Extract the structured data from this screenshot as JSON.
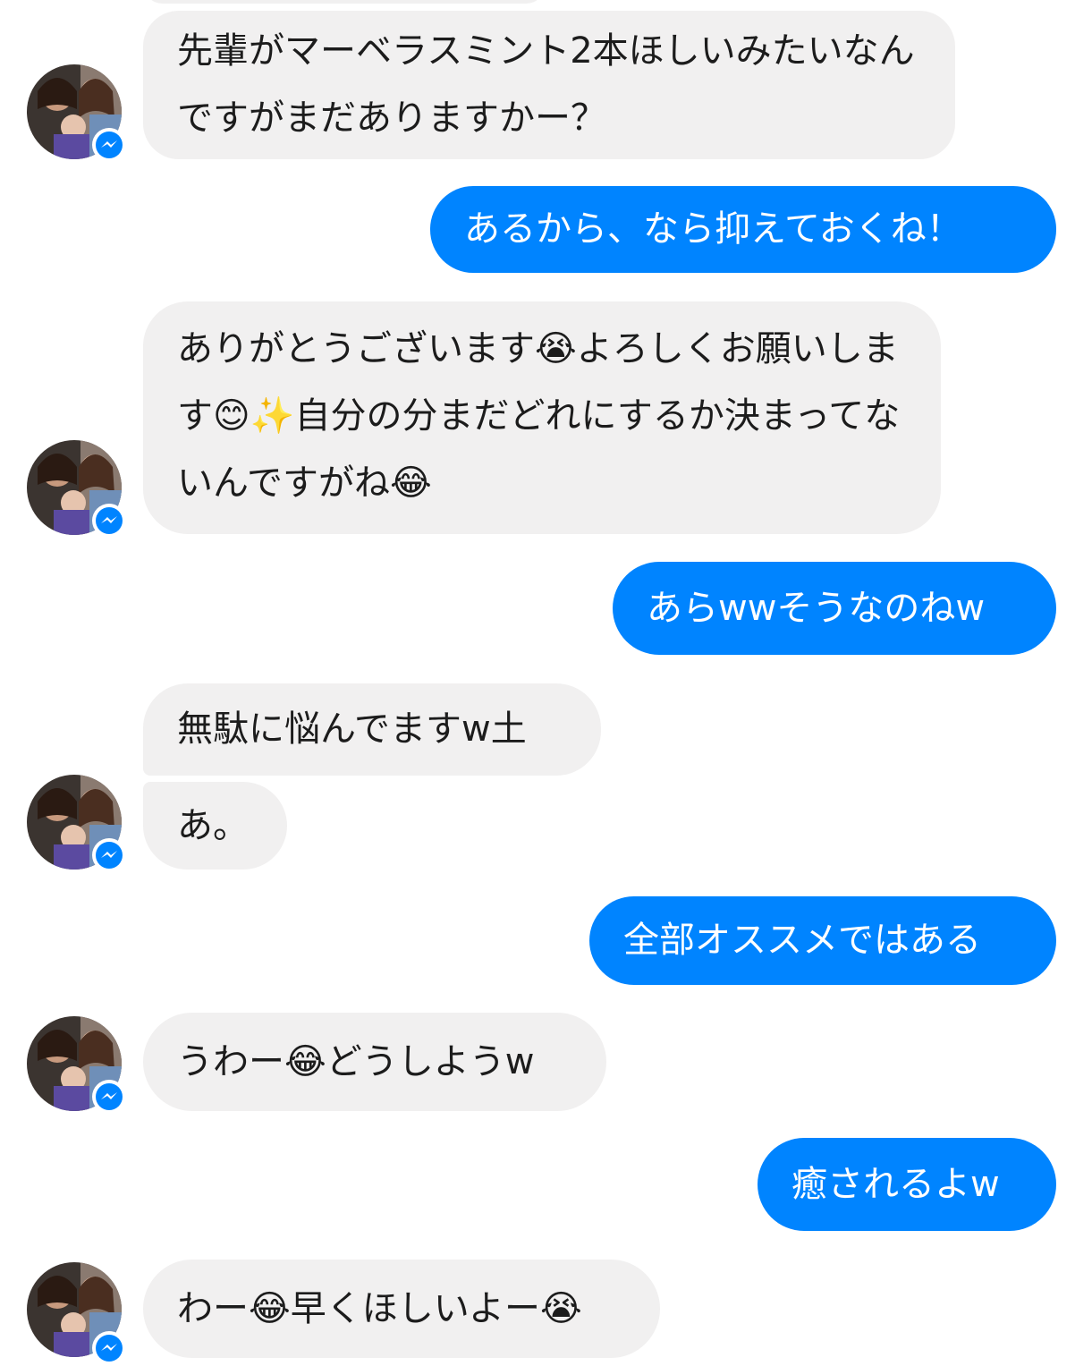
{
  "contact": {
    "avatar_icon": "contact-avatar",
    "badge_icon": "messenger-badge-icon"
  },
  "colors": {
    "outgoing_bubble": "#0084ff",
    "incoming_bubble": "#f1f0f0",
    "badge": "#0084ff"
  },
  "messages": [
    {
      "sender": "contact",
      "text": "先輩がマーベラスミント2本ほしいみたいなんですがまだありますかー？"
    },
    {
      "sender": "me",
      "text": "あるから、なら抑えておくね！"
    },
    {
      "sender": "contact",
      "text": "ありがとうございます😭よろしくお願いします😊✨自分の分まだどれにするか決まってないんですがね😂"
    },
    {
      "sender": "me",
      "text": "あらwwそうなのねw"
    },
    {
      "sender": "contact",
      "text": "無駄に悩んでますw土"
    },
    {
      "sender": "contact",
      "text": "あ。"
    },
    {
      "sender": "me",
      "text": "全部オススメではある"
    },
    {
      "sender": "contact",
      "text": "うわー😂どうしようw"
    },
    {
      "sender": "me",
      "text": "癒されるよw"
    },
    {
      "sender": "contact",
      "text": "わー😂早くほしいよー😭"
    }
  ]
}
